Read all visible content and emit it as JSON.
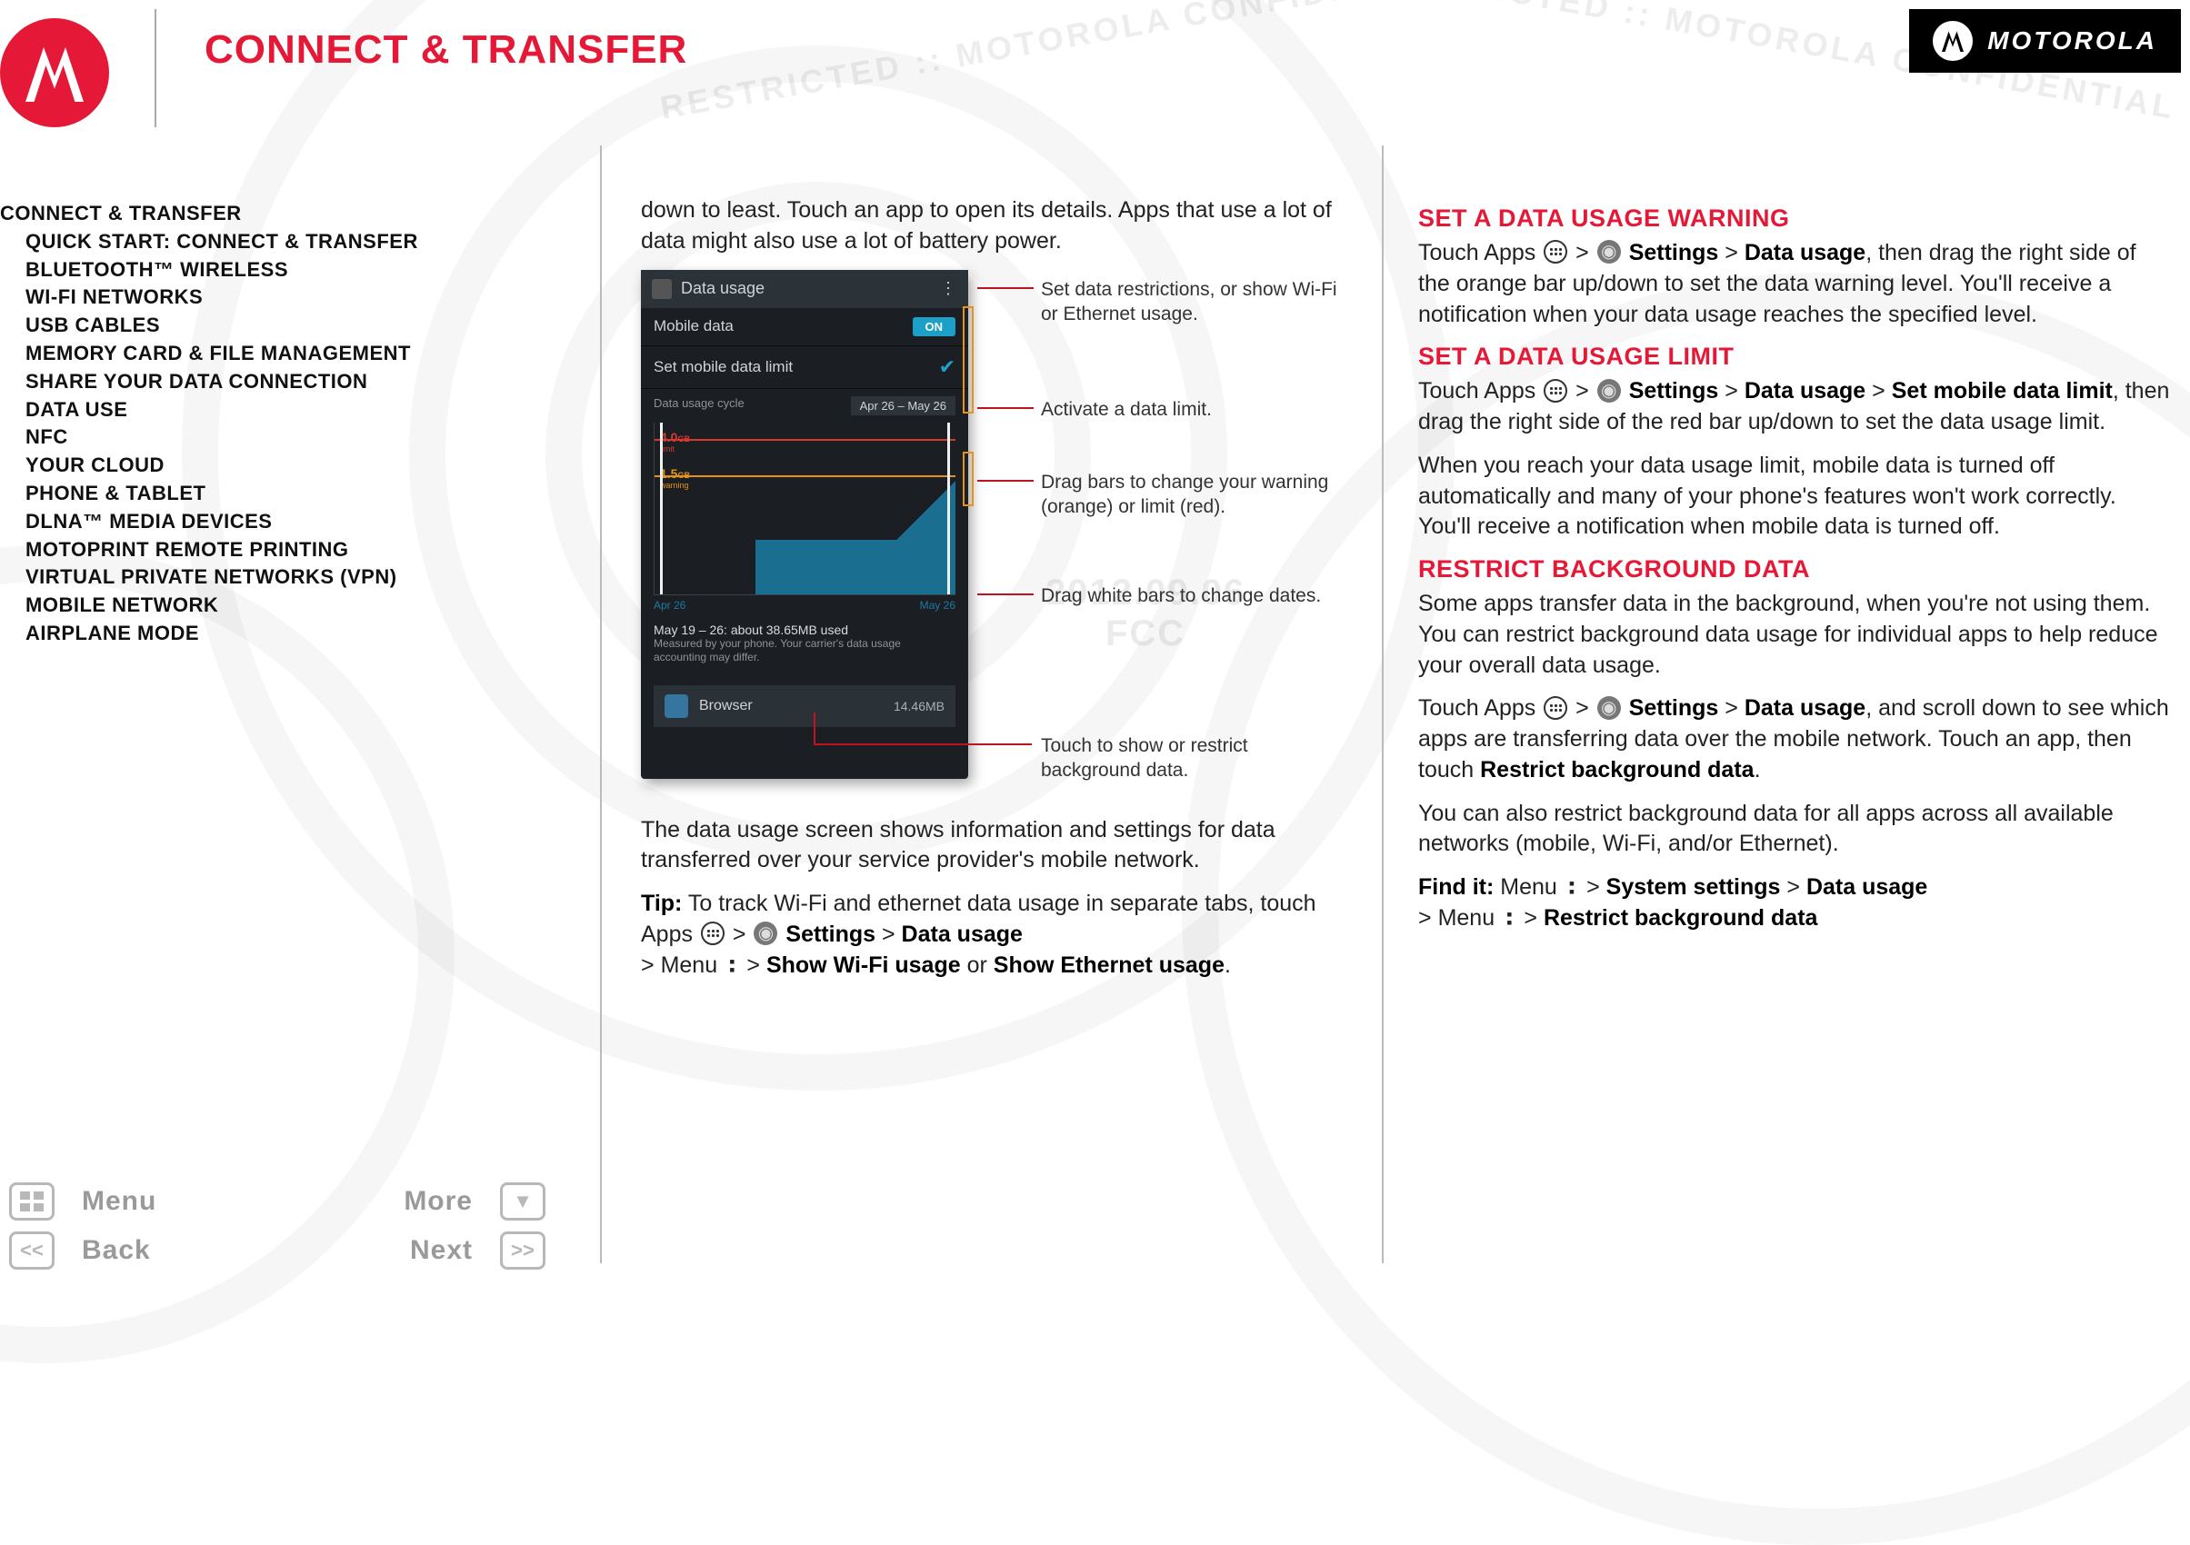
{
  "brand": "MOTOROLA",
  "page_title": "CONNECT & TRANSFER",
  "watermark": {
    "text": "RESTRICTED :: MOTOROLA CONFIDENTIAL",
    "date": "2012.09.06",
    "org": "FCC"
  },
  "sidebar": {
    "items": [
      {
        "label": "CONNECT & TRANSFER",
        "child": false
      },
      {
        "label": "QUICK START: CONNECT & TRANSFER",
        "child": true
      },
      {
        "label": "BLUETOOTH™ WIRELESS",
        "child": true
      },
      {
        "label": "WI-FI NETWORKS",
        "child": true
      },
      {
        "label": "USB CABLES",
        "child": true
      },
      {
        "label": "MEMORY CARD & FILE MANAGEMENT",
        "child": true
      },
      {
        "label": "SHARE YOUR DATA CONNECTION",
        "child": true
      },
      {
        "label": "DATA USE",
        "child": true
      },
      {
        "label": "NFC",
        "child": true
      },
      {
        "label": "YOUR CLOUD",
        "child": true
      },
      {
        "label": "PHONE & TABLET",
        "child": true
      },
      {
        "label": "DLNA™ MEDIA DEVICES",
        "child": true
      },
      {
        "label": "MOTOPRINT REMOTE PRINTING",
        "child": true
      },
      {
        "label": "VIRTUAL PRIVATE NETWORKS (VPN)",
        "child": true
      },
      {
        "label": "MOBILE NETWORK",
        "child": true
      },
      {
        "label": "AIRPLANE MODE",
        "child": true
      }
    ]
  },
  "col1": {
    "intro": "down to least. Touch an app to open its details. Apps that use a lot of data might also use a lot of battery power.",
    "figure": {
      "screen_title": "Data usage",
      "mobile_data_label": "Mobile data",
      "mobile_data_state": "ON",
      "limit_label": "Set mobile data limit",
      "cycle_label": "Data usage cycle",
      "cycle_value": "Apr 26 – May 26",
      "limit_value": "4.0",
      "limit_unit": "GB",
      "limit_word": "limit",
      "warn_value": "1.5",
      "warn_unit": "GB",
      "warn_word": "warning",
      "x_start": "Apr 26",
      "x_end": "May 26",
      "usage_line": "May 19 – 26: about 38.65MB used",
      "usage_note": "Measured by your phone. Your carrier's data usage accounting may differ.",
      "app_name": "Browser",
      "app_size": "14.46MB"
    },
    "callouts": {
      "c1": "Set data restrictions, or show Wi-Fi or Ethernet usage.",
      "c2": "Activate a data limit.",
      "c3": "Drag bars to change your warning (orange) or limit (red).",
      "c4": "Drag white bars to change dates.",
      "c5": "Touch to show or restrict background data."
    },
    "p2": "The data usage screen shows information and settings for data transferred over your service provider's mobile network.",
    "tip_label": "Tip:",
    "tip_a": " To track Wi-Fi and ethernet data usage in separate tabs, touch Apps ",
    "gt": ">",
    "settings": "Settings",
    "datausage": "Data usage",
    "menu_word": "Menu",
    "showwifi": "Show Wi-Fi usage",
    "or": " or ",
    "showeth": "Show Ethernet usage",
    "period": "."
  },
  "col2": {
    "h1": "SET A DATA USAGE WARNING",
    "p1a": "Touch Apps ",
    "p1b": ", then drag the right side of the orange bar up/down to set the data warning level. You'll receive a notification when your data usage reaches the specified level.",
    "h2": "SET A DATA USAGE LIMIT",
    "p2a": "Touch Apps ",
    "setlimit": "Set mobile data limit",
    "p2b": ", then drag the right side of the red bar up/down to set the data usage limit.",
    "p3": "When you reach your data usage limit, mobile data is turned off automatically and many of your phone's features won't work correctly. You'll receive a notification when mobile data is turned off.",
    "h3": "RESTRICT BACKGROUND DATA",
    "p4": "Some apps transfer data in the background, when you're not using them. You can restrict background data usage for individual apps to help reduce your overall data usage.",
    "p5a": "Touch Apps ",
    "p5b": ", and scroll down to see which apps are transferring data over the mobile network. Touch an app, then touch ",
    "restrict": "Restrict background data",
    "p6": "You can also restrict background data for all apps across all available networks (mobile, Wi-Fi, and/or Ethernet).",
    "findit": "Find it:",
    "syssettings": "System settings"
  },
  "footer": {
    "menu": "Menu",
    "more": "More",
    "back": "Back",
    "next": "Next"
  }
}
